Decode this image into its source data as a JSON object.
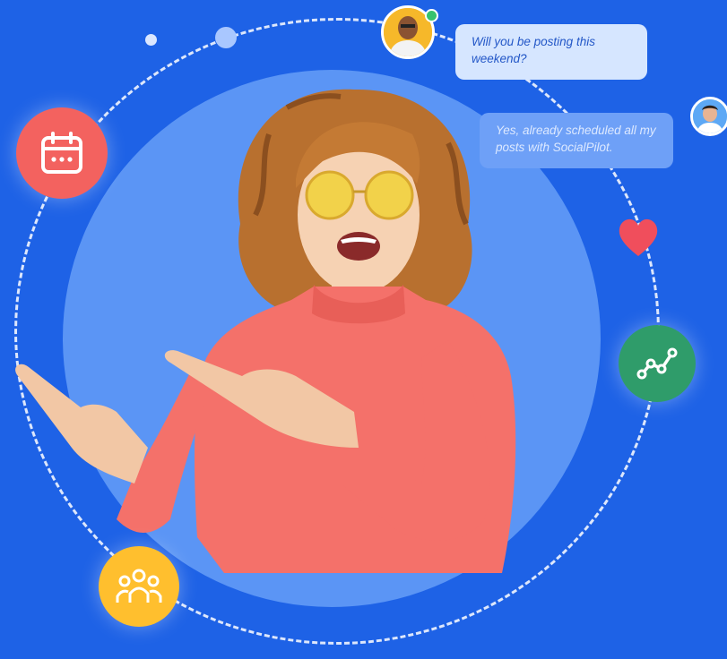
{
  "chat": {
    "message_1": "Will you be posting this weekend?",
    "message_2": "Yes, already scheduled all my posts with SocialPilot."
  },
  "icons": {
    "calendar": "calendar-icon",
    "analytics": "analytics-line-icon",
    "team": "team-icon",
    "heart": "heart-icon"
  },
  "colors": {
    "background": "#1e62e6",
    "inner_circle": "#5b95f5",
    "calendar_badge": "#f3625f",
    "analytics_badge": "#2f9c6a",
    "team_badge": "#ffbf2e",
    "heart": "#f04e5c",
    "sweater": "#f4716a"
  }
}
